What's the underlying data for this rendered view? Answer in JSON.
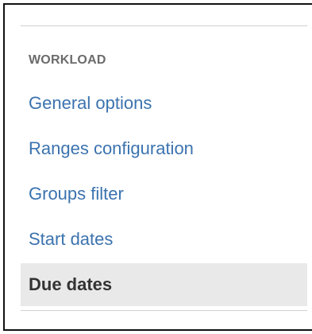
{
  "sidebar": {
    "heading": "WORKLOAD",
    "items": [
      {
        "label": "General options",
        "active": false
      },
      {
        "label": "Ranges configuration",
        "active": false
      },
      {
        "label": "Groups filter",
        "active": false
      },
      {
        "label": "Start dates",
        "active": false
      },
      {
        "label": "Due dates",
        "active": true
      }
    ]
  },
  "colors": {
    "link": "#3b73af",
    "heading": "#6b6b6b",
    "active_bg": "#e9e9e9",
    "active_text": "#333333",
    "divider": "#cfcfcf"
  }
}
